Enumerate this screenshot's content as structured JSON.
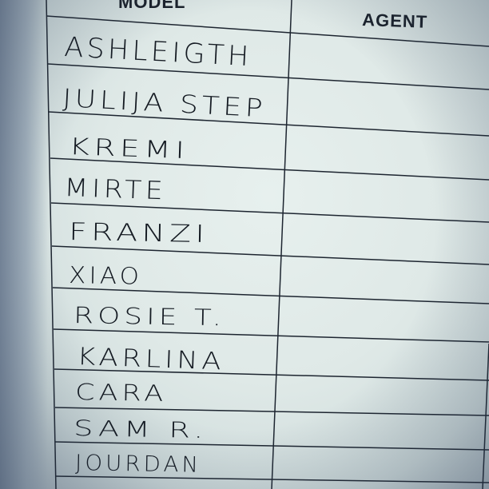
{
  "sheet": {
    "headers": {
      "model": "MODEL",
      "agent": "AGENT"
    },
    "models": [
      "ASHLEIGTH",
      "JULIJA STEP",
      "KREMI",
      "MIRTE",
      "FRANZI",
      "XIAO",
      "ROSIE T.",
      "KARLINA",
      "CARA",
      "SAM R.",
      "JOURDAN"
    ]
  }
}
